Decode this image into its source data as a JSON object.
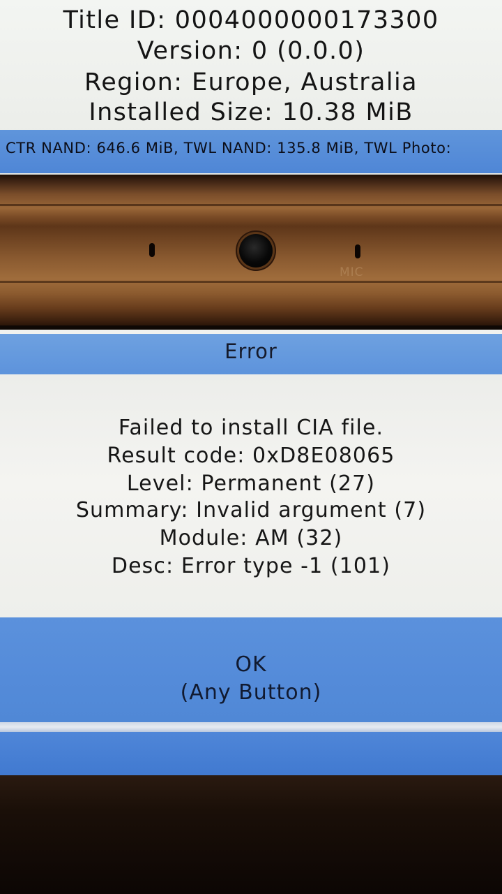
{
  "top_screen": {
    "title_id": "Title ID: 0004000000173300",
    "version": "Version: 0 (0.0.0)",
    "region": "Region: Europe, Australia",
    "installed_size": "Installed Size: 10.38 MiB",
    "status_bar": "CTR NAND: 646.6 MiB, TWL NAND: 135.8 MiB, TWL Photo:"
  },
  "hinge": {
    "mic_label": "MIC"
  },
  "dialog": {
    "title": "Error",
    "lines": [
      "Failed to install CIA file.",
      "Result code: 0xD8E08065",
      "Level: Permanent (27)",
      "Summary: Invalid argument (7)",
      "Module: AM (32)",
      "Desc: Error type -1 (101)"
    ],
    "ok_label": "OK",
    "ok_hint": "(Any Button)"
  },
  "colors": {
    "accent_blue": "#5d93dc",
    "screen_background": "#f1f2ef",
    "text": "#161616"
  }
}
